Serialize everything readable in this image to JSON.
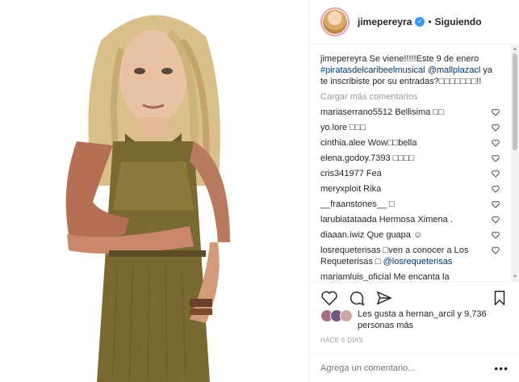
{
  "post": {
    "username": "jimepereyra",
    "verified_icon": "verified-badge-icon",
    "separator": "•",
    "follow_label": "Siguiendo",
    "caption_user": "jimepereyra",
    "caption_text": " Se viene!!!!!Este 9 de enero ",
    "caption_hashtag": "#piratasdelcaribeelmusical",
    "caption_mention": "@mallplazacl",
    "caption_rest": " ya te inscribiste por su entradas?□□□□□□□!!",
    "load_more": "Cargar más comentarios",
    "comments": [
      {
        "user": "mariaserrano5512",
        "text": " Bellisima □□"
      },
      {
        "user": "yo.lore",
        "text": " □□□"
      },
      {
        "user": "cinthia.alee",
        "text": " Wow□□bella"
      },
      {
        "user": "elena.godoy.7393",
        "text": " □□□□"
      },
      {
        "user": "cris341977",
        "text": " Fea"
      },
      {
        "user": "meryxploit",
        "text": " Rika"
      },
      {
        "user": "__fraanstones__",
        "text": " □"
      },
      {
        "user": "larubiatataada",
        "text": " Hermosa Ximena ."
      },
      {
        "user": "diaaan.iwiz",
        "text": " Que guapa ☺"
      },
      {
        "user": "losrequeterisas",
        "text": " □ven a conocer a Los Requeterisas □ ",
        "mention": "@losrequeterisas"
      },
      {
        "user": "mariamluis_oficial",
        "text": " Me encanta la"
      }
    ],
    "likes_text": "Les gusta a hernan_arcil y 9,736 personas más",
    "time": "HACE 5 DÍAS",
    "add_comment_placeholder": "Agrega un comentario...",
    "more_options": "•••"
  }
}
